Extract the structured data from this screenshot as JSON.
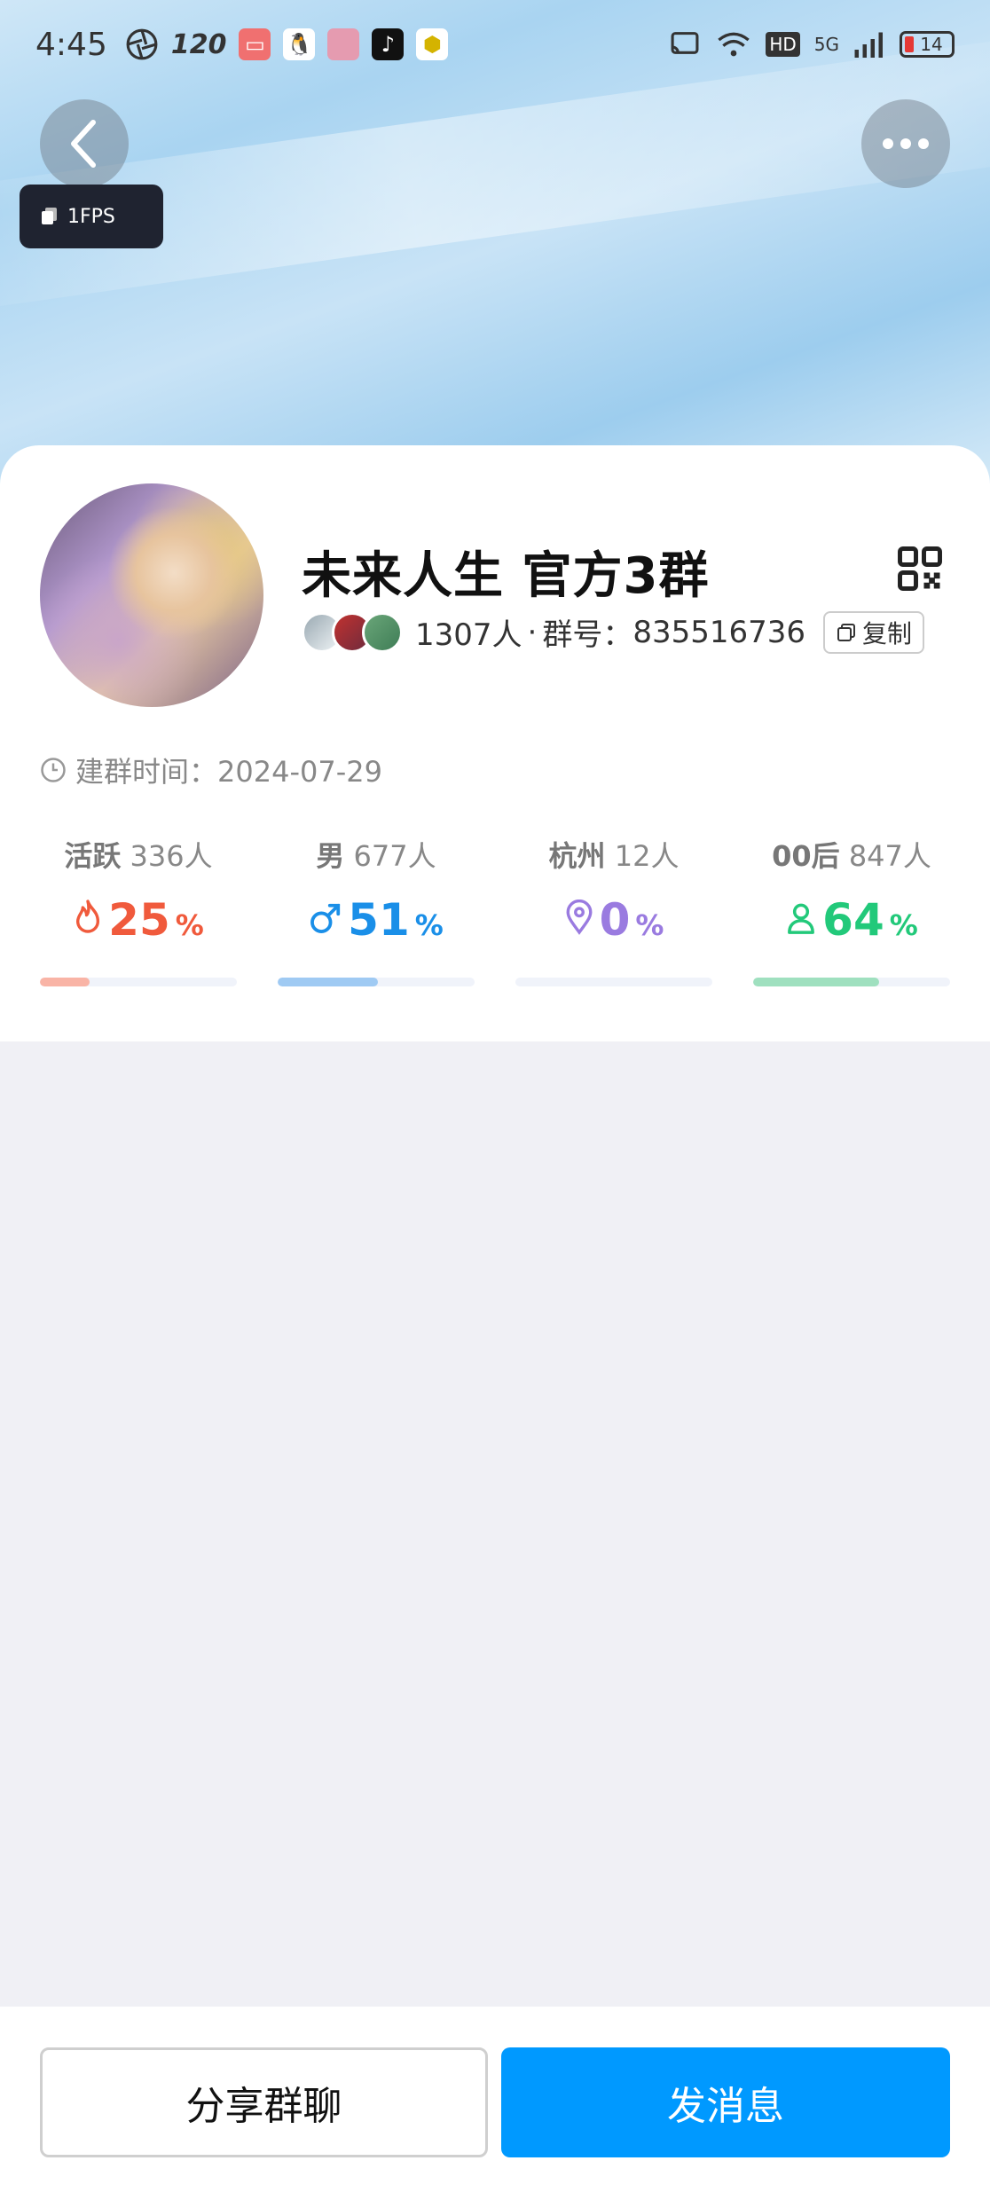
{
  "status_bar": {
    "time": "4:45",
    "refresh_rate": "120",
    "network": "5G",
    "hd": "HD",
    "battery": "14"
  },
  "overlay": {
    "fps": "1FPS"
  },
  "group": {
    "name": "未来人生 官方3群",
    "member_count": "1307人",
    "separator": "·",
    "id_label": "群号：",
    "id": "835516736",
    "copy_label": "复制",
    "created_label": "建群时间：",
    "created_date": "2024-07-29"
  },
  "stats": [
    {
      "label": "活跃",
      "count": "336人",
      "percent": "25",
      "unit": "%",
      "color": "#f05a3c",
      "bar_color": "#f9b4a6",
      "fill": 0.25,
      "icon": "flame-icon"
    },
    {
      "label": "男",
      "count": "677人",
      "percent": "51",
      "unit": "%",
      "color": "#1a8fe8",
      "bar_color": "#9fcaf3",
      "fill": 0.51,
      "icon": "male-icon"
    },
    {
      "label": "杭州",
      "count": "12人",
      "percent": "0",
      "unit": "%",
      "color": "#9a7be0",
      "bar_color": "#d6c9f5",
      "fill": 0.0,
      "icon": "location-pin-icon"
    },
    {
      "label": "00后",
      "count": "847人",
      "percent": "64",
      "unit": "%",
      "color": "#22c97a",
      "bar_color": "#9fe0bf",
      "fill": 0.64,
      "icon": "person-icon"
    }
  ],
  "actions": {
    "share_label": "分享群聊",
    "send_label": "发消息",
    "primary_color": "#0099ff"
  }
}
